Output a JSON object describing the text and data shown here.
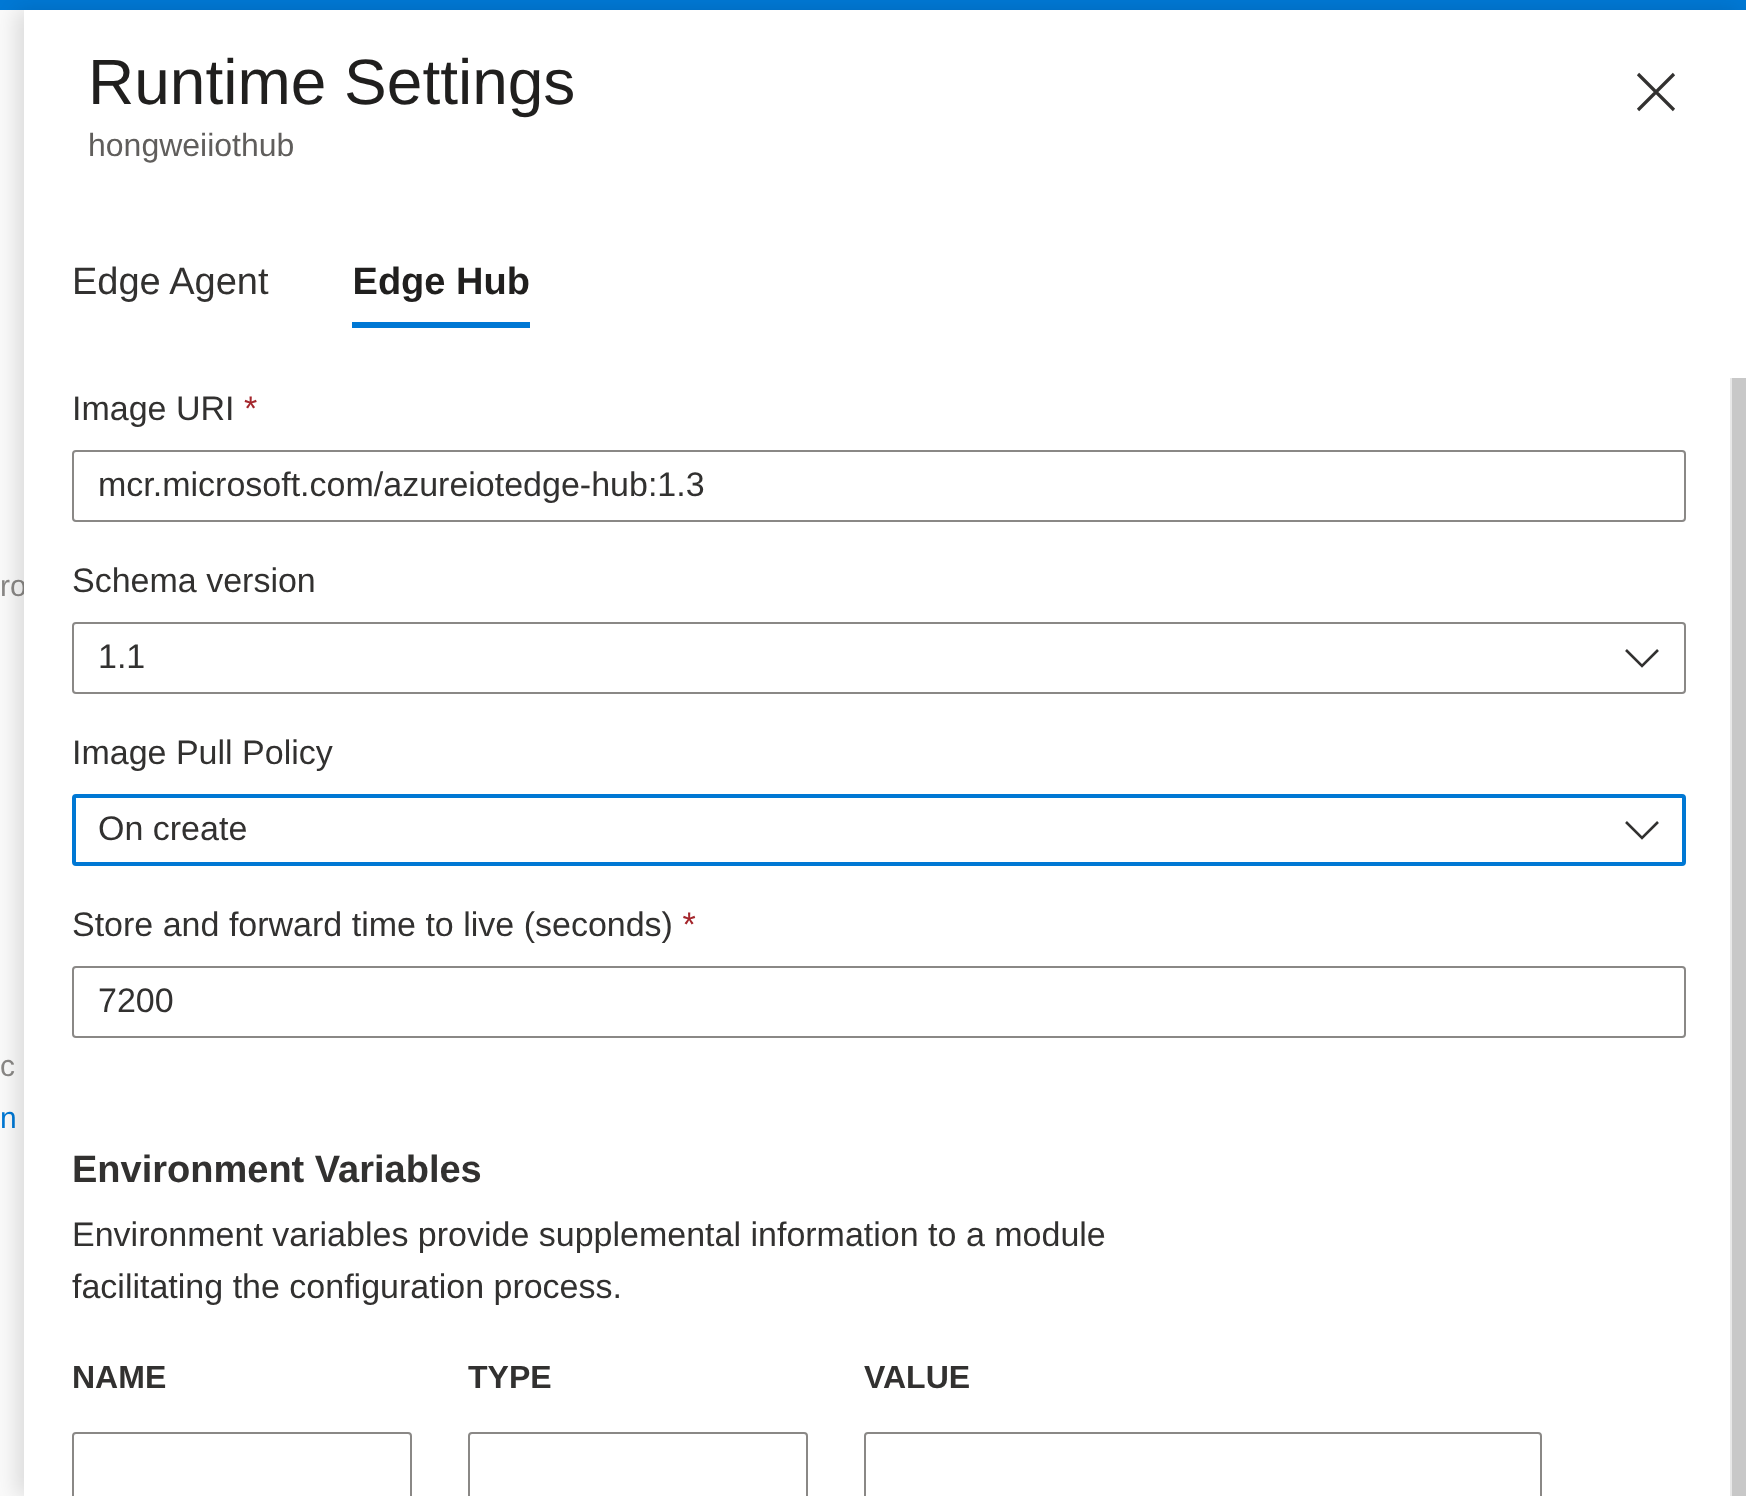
{
  "backdrop": [
    {
      "text": "ro",
      "kind": "text"
    },
    {
      "text": "c",
      "kind": "text"
    },
    {
      "text": "n",
      "kind": "link"
    }
  ],
  "panel": {
    "title": "Runtime Settings",
    "subtitle": "hongweiiothub"
  },
  "tabs": [
    {
      "label": "Edge Agent",
      "selected": false
    },
    {
      "label": "Edge Hub",
      "selected": true
    }
  ],
  "fields": [
    {
      "kind": "text",
      "label": "Image URI",
      "required_mark": "*",
      "value": "mcr.microsoft.com/azureiotedge-hub:1.3",
      "focused": false
    },
    {
      "kind": "select",
      "label": "Schema version",
      "value": "1.1",
      "focused": false
    },
    {
      "kind": "select",
      "label": "Image Pull Policy",
      "value": "On create",
      "focused": true
    },
    {
      "kind": "text",
      "label": "Store and forward time to live (seconds)",
      "required_mark": "*",
      "value": "7200",
      "focused": false
    }
  ],
  "environment_variables": {
    "heading": "Environment Variables",
    "description": "Environment variables provide supplemental information to a module facilitating the configuration process.",
    "columns": [
      "NAME",
      "TYPE",
      "VALUE"
    ]
  }
}
